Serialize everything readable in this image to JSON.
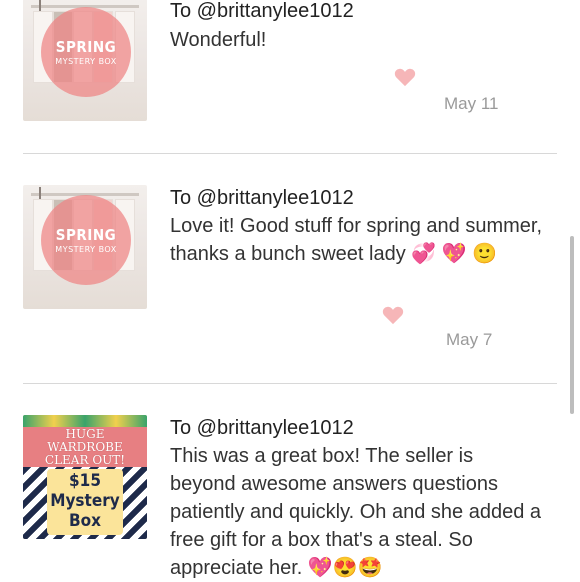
{
  "reviews": [
    {
      "recipient": "To @brittanylee1012",
      "message": "Wonderful!",
      "date": "May 11",
      "thumbnail": {
        "type": "spring",
        "title": "SPRING",
        "subtitle": "MYSTERY BOX"
      }
    },
    {
      "recipient": "To @brittanylee1012",
      "message": "Love it! Good stuff for spring and summer, thanks a bunch sweet lady 💞 💖 🙂",
      "date": "May 7",
      "thumbnail": {
        "type": "spring",
        "title": "SPRING",
        "subtitle": "MYSTERY BOX"
      }
    },
    {
      "recipient": "To @brittanylee1012",
      "message": "This was a great box! The seller is beyond awesome answers questions patiently and quickly. Oh and she added a free gift for a box that's a steal. So appreciate her. 💖😍🤩",
      "date": "",
      "thumbnail": {
        "type": "box",
        "line1": "HUGE",
        "line2": "WARDROBE",
        "line3": "CLEAR OUT!",
        "price": "$15",
        "line4": "Mystery",
        "line5": "Box"
      }
    }
  ],
  "icons": {
    "like": "heart-icon"
  },
  "colors": {
    "heart": "#f6b6b8",
    "date": "#9a9a9a",
    "separator": "#d8d8d8"
  }
}
